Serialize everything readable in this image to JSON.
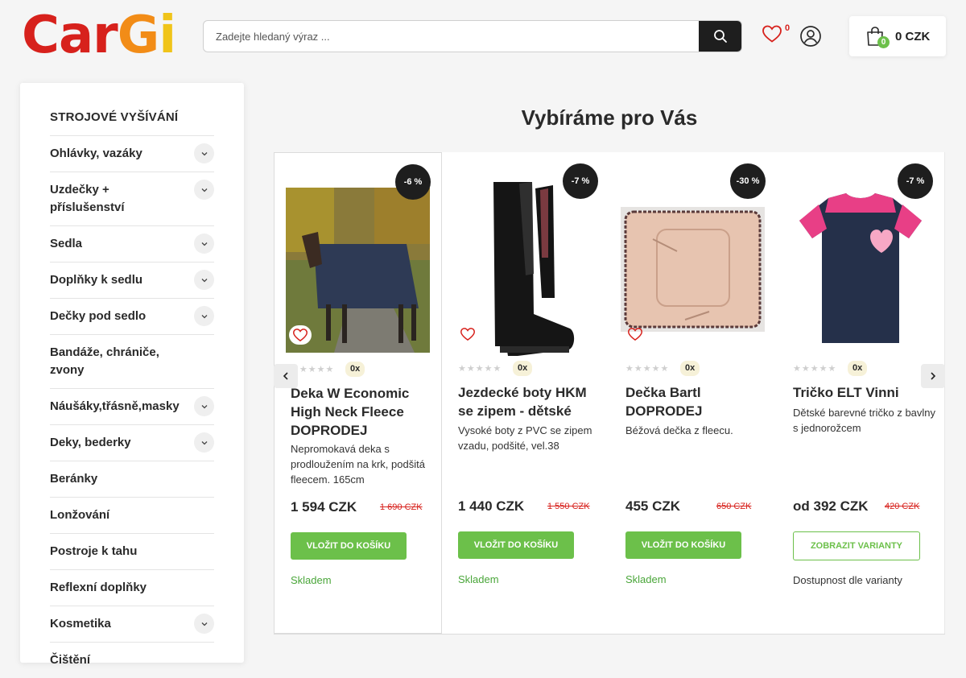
{
  "logo": {
    "part1": "Car",
    "part2": "G",
    "part3": "i"
  },
  "search": {
    "placeholder": "Zadejte hledaný výraz ..."
  },
  "header": {
    "wishlist_count": "0",
    "cart_count": "0",
    "cart_total": "0 CZK"
  },
  "sidebar": {
    "title": "STROJOVÉ VYŠÍVÁNÍ",
    "items": [
      {
        "label": "Ohlávky, vazáky",
        "expandable": true
      },
      {
        "label": "Uzdečky + příslušenství",
        "expandable": true
      },
      {
        "label": "Sedla",
        "expandable": true
      },
      {
        "label": "Doplňky k sedlu",
        "expandable": true
      },
      {
        "label": "Dečky pod sedlo",
        "expandable": true
      },
      {
        "label": "Bandáže, chrániče, zvony",
        "expandable": false
      },
      {
        "label": "Náušáky,třásně,masky",
        "expandable": true
      },
      {
        "label": "Deky, bederky",
        "expandable": true
      },
      {
        "label": "Beránky",
        "expandable": false
      },
      {
        "label": "Lonžování",
        "expandable": false
      },
      {
        "label": "Postroje k tahu",
        "expandable": false
      },
      {
        "label": "Reflexní doplňky",
        "expandable": false
      },
      {
        "label": "Kosmetika",
        "expandable": true
      },
      {
        "label": "Čištění",
        "expandable": false
      }
    ]
  },
  "main": {
    "title": "Vybíráme pro Vás",
    "products": [
      {
        "discount": "-6 %",
        "rating_count": "0x",
        "name": "Deka W Economic High Neck Fleece DOPRODEJ",
        "description": "Nepromokavá deka s prodloužením na krk, podšitá fleecem. 165cm",
        "price": "1 594 CZK",
        "old_price": "1 690 CZK",
        "button": "VLOŽIT DO KOŠÍKU",
        "availability": "Skladem"
      },
      {
        "discount": "-7 %",
        "rating_count": "0x",
        "name": "Jezdecké boty HKM se zipem - dětské",
        "description": "Vysoké boty z PVC se zipem vzadu, podšité, vel.38",
        "price": "1 440 CZK",
        "old_price": "1 550 CZK",
        "button": "VLOŽIT DO KOŠÍKU",
        "availability": "Skladem"
      },
      {
        "discount": "-30 %",
        "rating_count": "0x",
        "name": "Dečka Bartl DOPRODEJ",
        "description": "Béžová dečka z fleecu.",
        "price": "455 CZK",
        "old_price": "650 CZK",
        "button": "VLOŽIT DO KOŠÍKU",
        "availability": "Skladem"
      },
      {
        "discount": "-7 %",
        "rating_count": "0x",
        "name": "Tričko ELT Vinni",
        "description": "Dětské barevné tričko z bavlny s jednorožcem",
        "price": "od 392 CZK",
        "old_price": "420 CZK",
        "button": "ZOBRAZIT VARIANTY",
        "availability": "Dostupnost dle varianty"
      }
    ]
  },
  "colors": {
    "accent_green": "#6cc04a",
    "badge_dark": "#1e1e1e",
    "old_price_red": "#d7211c"
  },
  "icons": [
    "search-icon",
    "heart-icon",
    "user-icon",
    "cart-icon",
    "chevron-down-icon",
    "arrow-left-icon",
    "arrow-right-icon",
    "star-icon"
  ]
}
